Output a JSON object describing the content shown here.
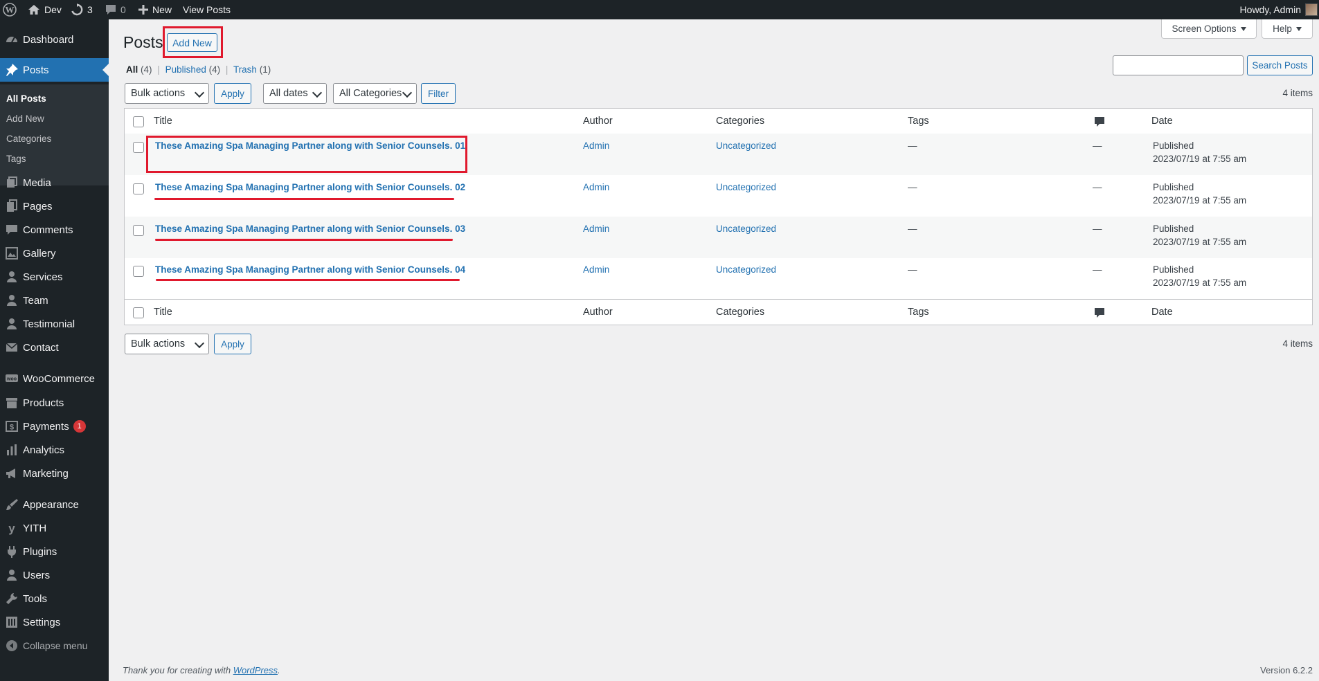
{
  "adminbar": {
    "site_name": "Dev",
    "updates_count": "3",
    "comments_count": "0",
    "new_label": "New",
    "view_posts_label": "View Posts",
    "howdy": "Howdy, Admin"
  },
  "sidebar": {
    "dashboard": "Dashboard",
    "posts": "Posts",
    "sub": {
      "all_posts": "All Posts",
      "add_new": "Add New",
      "categories": "Categories",
      "tags": "Tags"
    },
    "media": "Media",
    "pages": "Pages",
    "comments": "Comments",
    "gallery": "Gallery",
    "services": "Services",
    "team": "Team",
    "testimonial": "Testimonial",
    "contact": "Contact",
    "woocommerce": "WooCommerce",
    "products": "Products",
    "payments": "Payments",
    "payments_badge": "1",
    "analytics": "Analytics",
    "marketing": "Marketing",
    "appearance": "Appearance",
    "yith": "YITH",
    "plugins": "Plugins",
    "users": "Users",
    "tools": "Tools",
    "settings": "Settings",
    "collapse": "Collapse menu"
  },
  "header": {
    "title": "Posts",
    "add_new": "Add New",
    "screen_options": "Screen Options",
    "help": "Help"
  },
  "views": {
    "all": "All",
    "all_count": "(4)",
    "published": "Published",
    "published_count": "(4)",
    "trash": "Trash",
    "trash_count": "(1)",
    "sep": "|"
  },
  "search": {
    "value": "",
    "button": "Search Posts"
  },
  "filters": {
    "bulk_actions": "Bulk actions",
    "apply": "Apply",
    "all_dates": "All dates",
    "all_categories": "All Categories",
    "filter": "Filter",
    "items_count": "4 items"
  },
  "table": {
    "columns": {
      "title": "Title",
      "author": "Author",
      "categories": "Categories",
      "tags": "Tags",
      "date": "Date"
    },
    "rows": [
      {
        "title": "These Amazing Spa Managing Partner along with Senior Counsels. 01",
        "author": "Admin",
        "category": "Uncategorized",
        "tags": "—",
        "comments": "—",
        "status": "Published",
        "date": "2023/07/19 at 7:55 am"
      },
      {
        "title": "These Amazing Spa Managing Partner along with Senior Counsels. 02",
        "author": "Admin",
        "category": "Uncategorized",
        "tags": "—",
        "comments": "—",
        "status": "Published",
        "date": "2023/07/19 at 7:55 am"
      },
      {
        "title": "These Amazing Spa Managing Partner along with Senior Counsels. 03",
        "author": "Admin",
        "category": "Uncategorized",
        "tags": "—",
        "comments": "—",
        "status": "Published",
        "date": "2023/07/19 at 7:55 am"
      },
      {
        "title": "These Amazing Spa Managing Partner along with Senior Counsels. 04",
        "author": "Admin",
        "category": "Uncategorized",
        "tags": "—",
        "comments": "—",
        "status": "Published",
        "date": "2023/07/19 at 7:55 am"
      }
    ]
  },
  "footer": {
    "thank_you": "Thank you for creating with ",
    "wordpress_link": "WordPress",
    "period": ".",
    "version": "Version 6.2.2"
  },
  "colors": {
    "accent": "#2271b1",
    "admin_dark": "#1d2327",
    "annotation_red": "#e0192d"
  }
}
